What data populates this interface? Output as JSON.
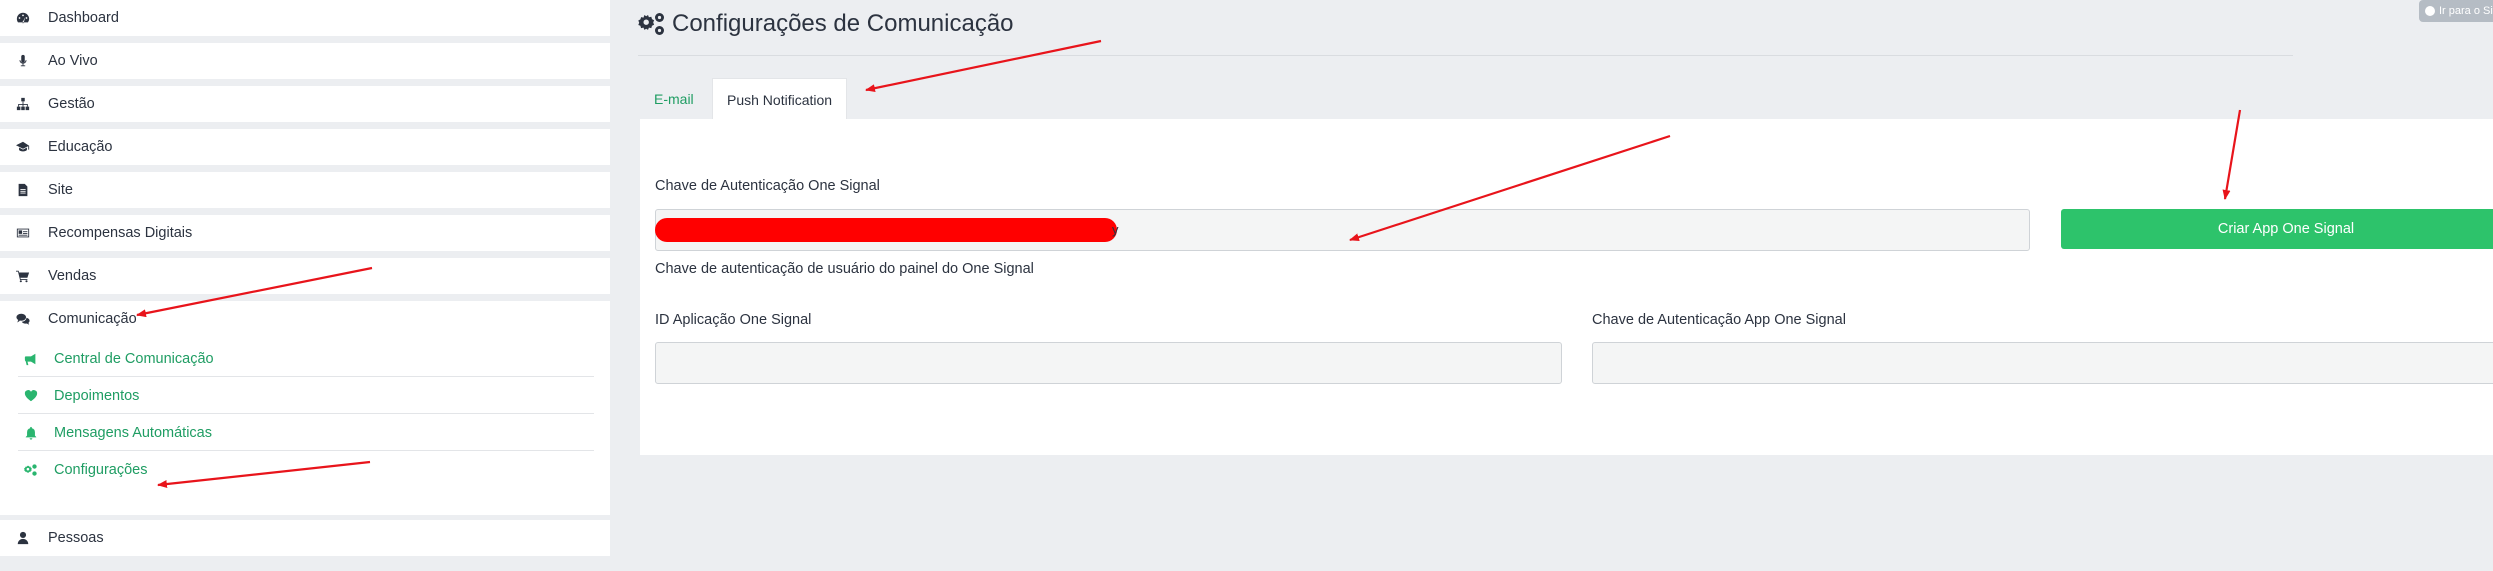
{
  "sidebar": {
    "items": [
      {
        "label": "Dashboard",
        "icon": "dashboard-icon"
      },
      {
        "label": "Ao Vivo",
        "icon": "microphone-icon"
      },
      {
        "label": "Gestão",
        "icon": "sitemap-icon"
      },
      {
        "label": "Educação",
        "icon": "graduation-cap-icon"
      },
      {
        "label": "Site",
        "icon": "file-icon"
      },
      {
        "label": "Recompensas Digitais",
        "icon": "id-card-icon"
      },
      {
        "label": "Vendas",
        "icon": "shopping-cart-icon"
      },
      {
        "label": "Comunicação",
        "icon": "comments-icon"
      },
      {
        "label": "Pessoas",
        "icon": "user-icon"
      }
    ],
    "sub_items": [
      {
        "label": "Central de Comunicação",
        "icon": "bullhorn-icon"
      },
      {
        "label": "Depoimentos",
        "icon": "heart-icon"
      },
      {
        "label": "Mensagens Automáticas",
        "icon": "bell-icon"
      },
      {
        "label": "Configurações",
        "icon": "cogs-icon"
      }
    ]
  },
  "header": {
    "title": "Configurações de Comunicação",
    "badge": "Ir para o Site"
  },
  "tabs": [
    {
      "label": "E-mail",
      "active": false
    },
    {
      "label": "Push Notification",
      "active": true
    }
  ],
  "form": {
    "auth_key_label": "Chave de Autenticação One Signal",
    "auth_key_value_tail": "y",
    "auth_key_help": "Chave de autenticação de usuário do painel do One Signal",
    "create_button": "Criar App One Signal",
    "app_id_label": "ID Aplicação One Signal",
    "app_id_value": "",
    "app_key_label": "Chave de Autenticação App One Signal",
    "app_key_value": ""
  },
  "colors": {
    "accent_green": "#2dc36b",
    "link_green": "#1f9d63",
    "annotation_red": "#e8141b",
    "redaction_red": "#ff0000"
  }
}
